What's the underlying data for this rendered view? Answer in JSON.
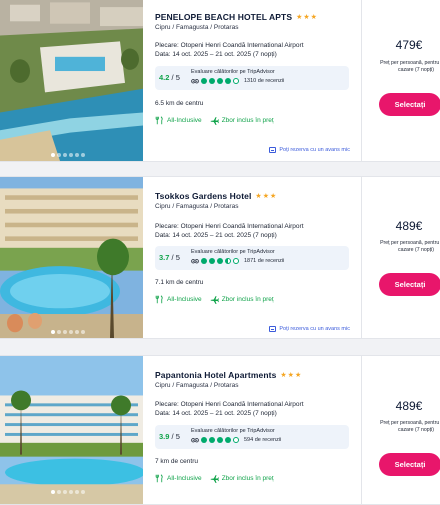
{
  "colors": {
    "accent": "#e8166b",
    "rating_green": "#10a34a",
    "tripadvisor_green": "#00aa6c",
    "star_gold": "#f5a623",
    "link_blue": "#3b5bdb"
  },
  "common": {
    "location": "Cipru / Famagusta / Protaras",
    "flight": "Plecare: Otopeni Henri Coandă International Airport",
    "dates": "Data: 14 oct. 2025 – 21 oct. 2025 (7 nopți)",
    "ta_title": "Evaluare călătorilor pe TripAdvisor",
    "feature_allinc": "All-Inclusive",
    "feature_flight": "Zbor inclus în preț",
    "pay_link": "Poți rezerva cu un avans mic",
    "price_note": "Preț per persoană, pentru sejur cazare (7 nopți)",
    "select_label": "Selectați",
    "stars": "★★★",
    "owl_icon": "tripadvisor-owl-icon"
  },
  "hotels": [
    {
      "name": "PENELOPE BEACH HOTEL APTS",
      "rating_score": "4.2",
      "rating_max": " / 5",
      "bubbles": 4,
      "reviews": "1310 de recenzii",
      "distance": "6.5 km de centru",
      "price": "479€",
      "photo_index": 0,
      "photo_count": 6
    },
    {
      "name": "Tsokkos Gardens Hotel",
      "rating_score": "3.7",
      "rating_max": " / 5",
      "bubbles": 3.5,
      "reviews": "1871 de recenzii",
      "distance": "7.1 km de centru",
      "price": "489€",
      "photo_index": 0,
      "photo_count": 6
    },
    {
      "name": "Papantonia Hotel Apartments",
      "rating_score": "3.9",
      "rating_max": " / 5",
      "bubbles": 4,
      "reviews": "594 de recenzii",
      "distance": "7 km de centru",
      "price": "489€",
      "photo_index": 0,
      "photo_count": 6
    }
  ]
}
